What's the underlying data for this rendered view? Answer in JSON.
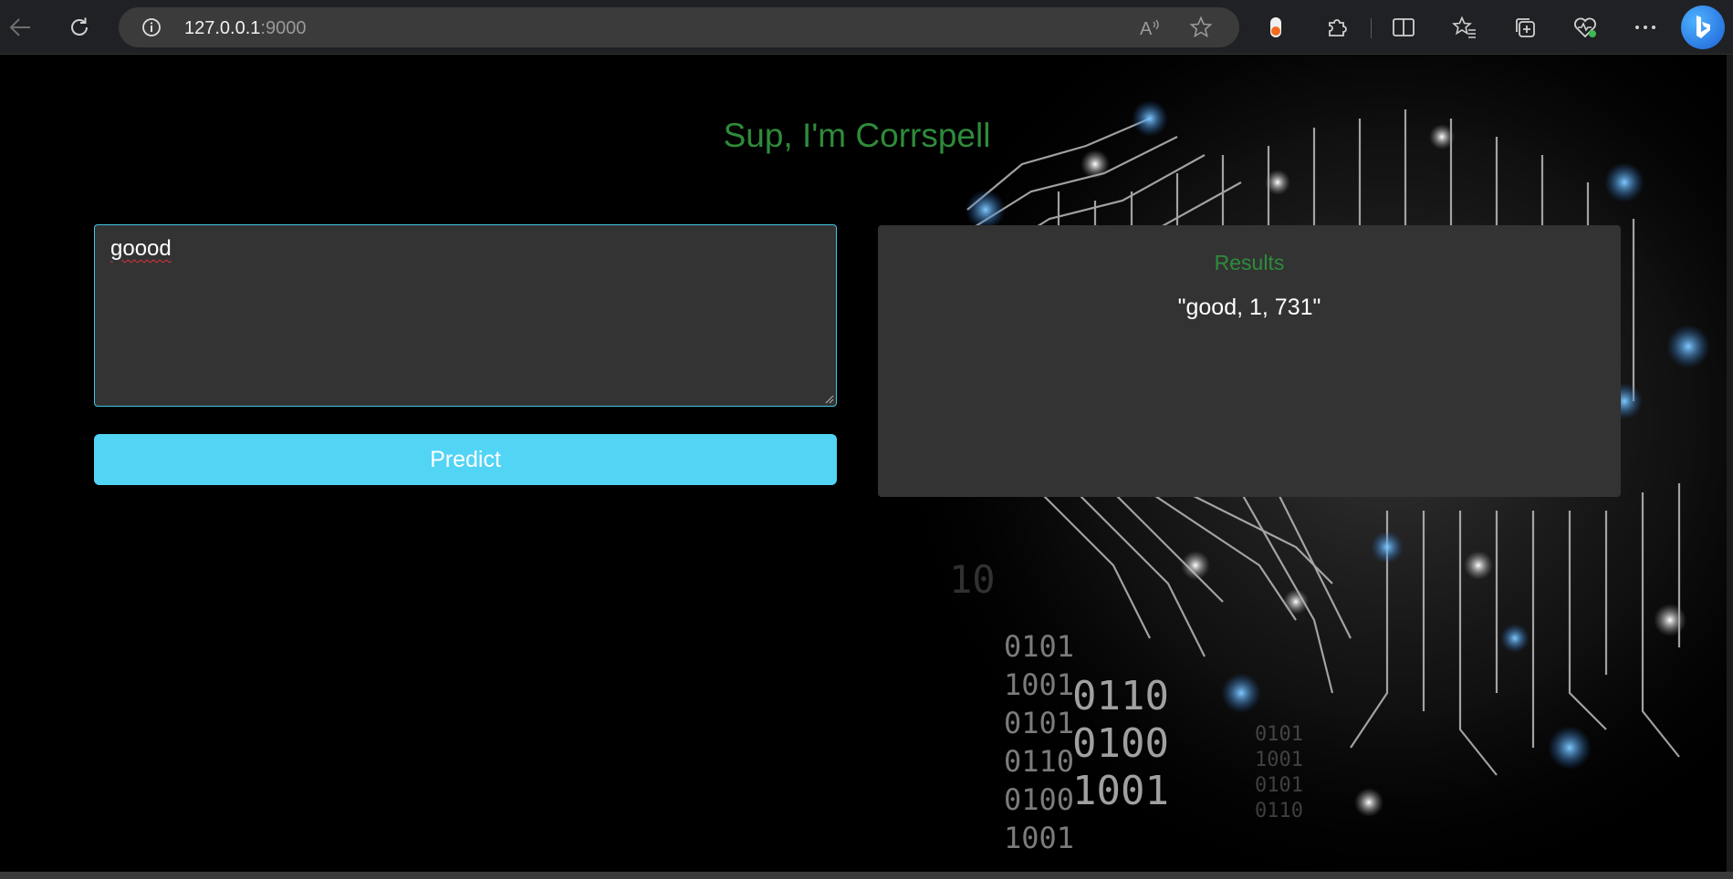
{
  "browser": {
    "url_host": "127.0.0.1",
    "url_port": ":9000",
    "icons": [
      "back-arrow-icon",
      "refresh-icon",
      "site-info-icon",
      "read-aloud-icon",
      "favorite-star-icon",
      "extension-toggle-icon",
      "extensions-puzzle-icon",
      "split-screen-icon",
      "favorites-icon",
      "collections-icon",
      "browser-essentials-icon",
      "more-menu-icon",
      "bing-copilot-icon"
    ]
  },
  "page": {
    "title": "Sup, I'm Corrspell",
    "input": {
      "value": "goood"
    },
    "predict_label": "Predict",
    "results": {
      "title": "Results",
      "value": "\"good, 1, 731\""
    },
    "background_digits": [
      "0101",
      "1001",
      "0101",
      "0110",
      "0100",
      "1001",
      "0110",
      "0100",
      "1001",
      "10",
      "0101",
      "1001",
      "0101",
      "0110"
    ],
    "colors": {
      "title_green": "#2e8b3a",
      "button_cyan": "#52d4f5",
      "panel": "#333333"
    }
  }
}
